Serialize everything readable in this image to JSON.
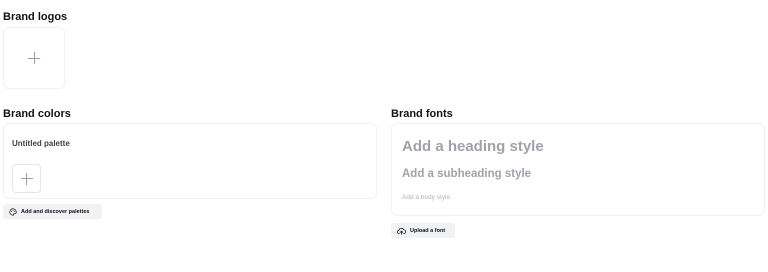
{
  "logos": {
    "title": "Brand logos",
    "add_icon": "plus-icon"
  },
  "colors": {
    "title": "Brand colors",
    "palette_name": "Untitled palette",
    "add_swatch_icon": "plus-icon",
    "discover_button": {
      "label": "Add and discover palettes",
      "icon": "palette-icon"
    }
  },
  "fonts": {
    "title": "Brand fonts",
    "heading": "Add a heading style",
    "subheading": "Add a subheading style",
    "body": "Add a body style",
    "upload_button": {
      "label": "Upload a font",
      "icon": "cloud-upload-icon"
    }
  }
}
